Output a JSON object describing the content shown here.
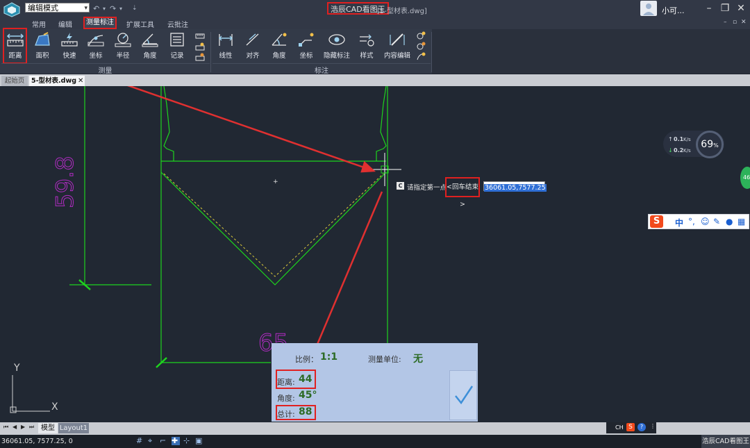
{
  "titlebar": {
    "mode": "编辑模式",
    "app_title": "浩辰CAD看图王",
    "file_title": "[5-型材表.dwg]",
    "username": "小可..."
  },
  "menu": {
    "tabs": [
      "常用",
      "编辑",
      "测量标注",
      "扩展工具",
      "云批注"
    ],
    "active": "测量标注"
  },
  "ribbon": {
    "measure_group": {
      "label": "测量",
      "buttons": [
        "距离",
        "面积",
        "快速",
        "坐标",
        "半径",
        "角度",
        "记录"
      ]
    },
    "annotate_group": {
      "label": "标注",
      "buttons": [
        "线性",
        "对齐",
        "角度",
        "坐标",
        "隐藏标注",
        "样式",
        "内容编辑"
      ]
    }
  },
  "doc_tabs": {
    "start": "起始页",
    "file": "5-型材表.dwg",
    "close": "✕"
  },
  "drawing": {
    "dim_vertical": "59.8",
    "dim_horizontal": "65",
    "axis_x": "X",
    "axis_y": "Y"
  },
  "command": {
    "icon": "C",
    "prompt": "请指定第一点",
    "enter_hint": "<回车结束>",
    "coord_value": "36061.05,7577.25"
  },
  "speed_widget": {
    "up": "0.1",
    "up_unit": "K/s",
    "down": "0.2",
    "down_unit": "K/s",
    "percent": "69",
    "percent_unit": "%",
    "badge": "46"
  },
  "ime": {
    "logo": "S",
    "lang": "中",
    "punct": "°,",
    "mini_label": "CH"
  },
  "measure_panel": {
    "scale_label": "比例：",
    "scale_value": "1:1",
    "unit_label": "测量单位:",
    "unit_value": "无",
    "distance_label": "距离:",
    "distance_value": "44",
    "angle_label": "角度:",
    "angle_value": "45°",
    "total_label": "总计:",
    "total_value": "88"
  },
  "layout_tabs": {
    "model": "模型",
    "layout1": "Layout1"
  },
  "statusbar": {
    "coords": "36061.05, 7577.25, 0",
    "app": "浩辰CAD看图王"
  },
  "colors": {
    "canvas_bg": "#212833",
    "cad_line": "#1ed41e",
    "cad_dim_text": "#b22cc4",
    "highlight_red": "#e02020",
    "dashed_yellow": "#d9c93a"
  }
}
